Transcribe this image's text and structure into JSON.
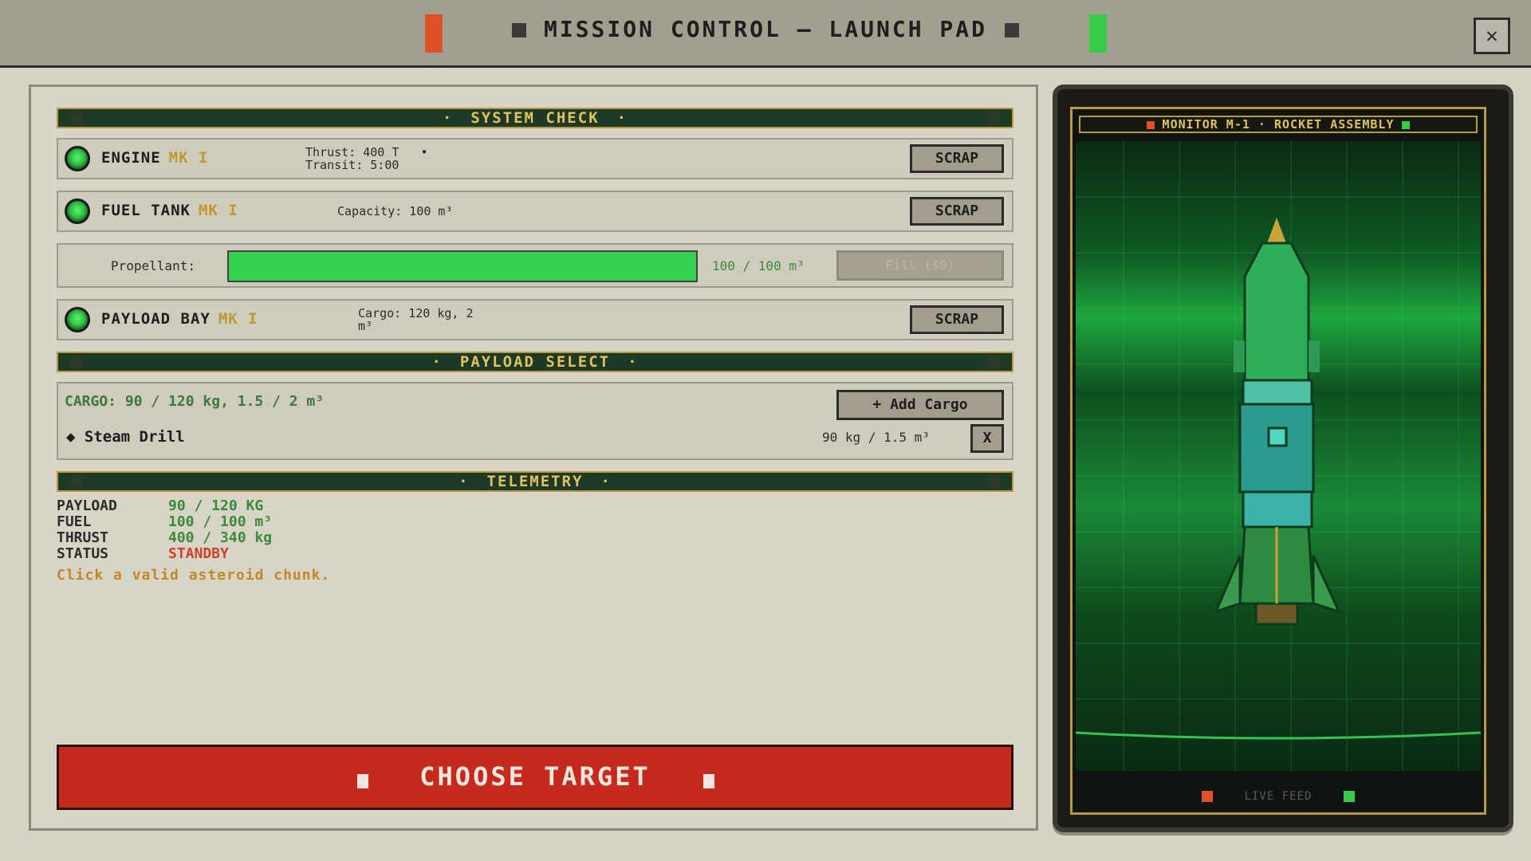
{
  "header": {
    "title": "MISSION CONTROL — LAUNCH PAD",
    "close_label": "✕"
  },
  "colors": {
    "accent_gold": "#e2c25a",
    "ok_green": "#35d04f",
    "alert_red": "#c62a1e",
    "panel_dark": "#1e3a26"
  },
  "system_check": {
    "title": "SYSTEM CHECK",
    "modules": [
      {
        "name": "ENGINE",
        "mk": "MK I",
        "stats": "Thrust: 400 T   •\nTransit: 5:00",
        "button": "SCRAP",
        "status_icon": "status-led-green"
      },
      {
        "name": "FUEL TANK",
        "mk": "MK I",
        "stats": "Capacity: 100 m³",
        "button": "SCRAP",
        "status_icon": "status-led-green"
      },
      {
        "name": "PAYLOAD BAY",
        "mk": "MK I",
        "stats": "Cargo: 120 kg, 2\nm³",
        "button": "SCRAP",
        "status_icon": "status-led-green"
      }
    ],
    "propellant": {
      "label": "Propellant:",
      "fill_fraction": 1.0,
      "value": "100 / 100 m³",
      "button": "Fill ($0)"
    }
  },
  "payload_select": {
    "title": "PAYLOAD SELECT",
    "summary": "CARGO: 90 / 120 kg, 1.5 / 2 m³",
    "add_button": "+ Add Cargo",
    "items": [
      {
        "name": "◆ Steam Drill",
        "meta": "90 kg / 1.5 m³",
        "remove": "X"
      }
    ]
  },
  "telemetry": {
    "title": "TELEMETRY",
    "rows": [
      {
        "key": "PAYLOAD",
        "value": "90 / 120 KG"
      },
      {
        "key": "FUEL",
        "value": "100 / 100 m³"
      },
      {
        "key": "THRUST",
        "value": "400 / 340 kg"
      },
      {
        "key": "STATUS",
        "value": "STANDBY"
      }
    ],
    "hint": "Click a valid asteroid chunk."
  },
  "primary_action": {
    "label": "CHOOSE TARGET"
  },
  "monitor": {
    "title_left": "MONITOR M-1",
    "title_right": "ROCKET ASSEMBLY",
    "footer": "LIVE FEED"
  }
}
